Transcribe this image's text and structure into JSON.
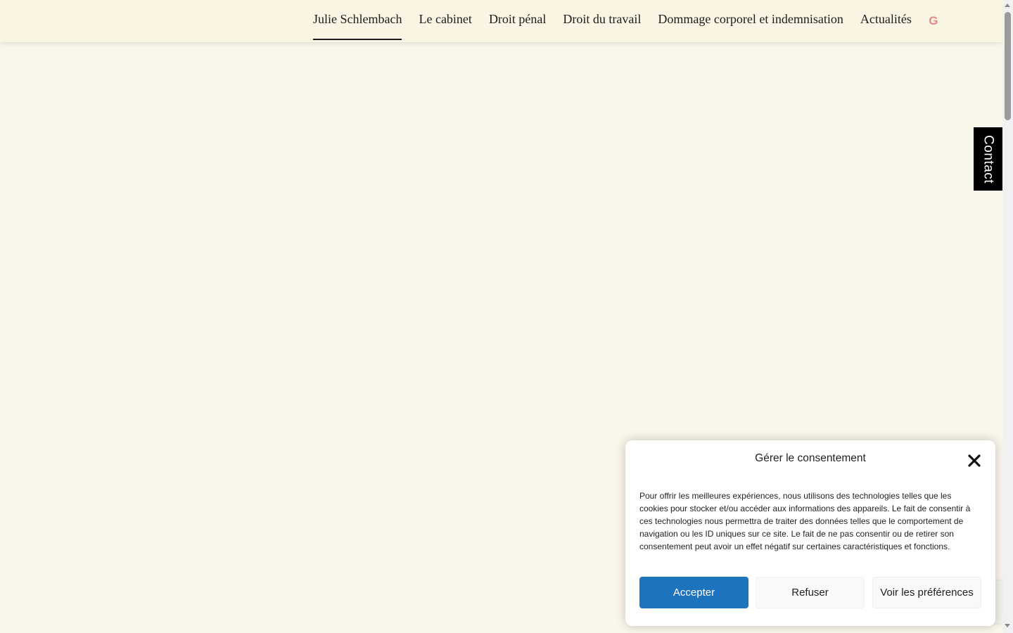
{
  "header": {
    "nav": [
      {
        "label": "Julie Schlembach",
        "active": true
      },
      {
        "label": "Le cabinet"
      },
      {
        "label": "Droit pénal"
      },
      {
        "label": "Droit du travail"
      },
      {
        "label": "Dommage corporel et indemnisation"
      },
      {
        "label": "Actualités"
      }
    ],
    "google_icon_glyph": "G",
    "google_icon": "google-icon"
  },
  "contact_tab": {
    "label": "Contact"
  },
  "consent": {
    "title": "Gérer le consentement",
    "close_icon": "close-icon",
    "text": "Pour offrir les meilleures expériences, nous utilisons des technologies telles que les cookies pour stocker et/ou accéder aux informations des appareils. Le fait de consentir à ces technologies nous permettra de traiter des données telles que le comportement de navigation ou les ID uniques sur ce site. Le fait de ne pas consentir ou de retirer son consentement peut avoir un effet négatif sur certaines caractéristiques et fonctions.",
    "accept_label": "Accepter",
    "deny_label": "Refuser",
    "prefs_label": "Voir les préférences"
  },
  "colors": {
    "page_background": "#f9f6ea",
    "header_background": "#faf4e3",
    "accent": "#1e73be",
    "contact_tab": "#000000",
    "google_icon": "#e88a84"
  }
}
